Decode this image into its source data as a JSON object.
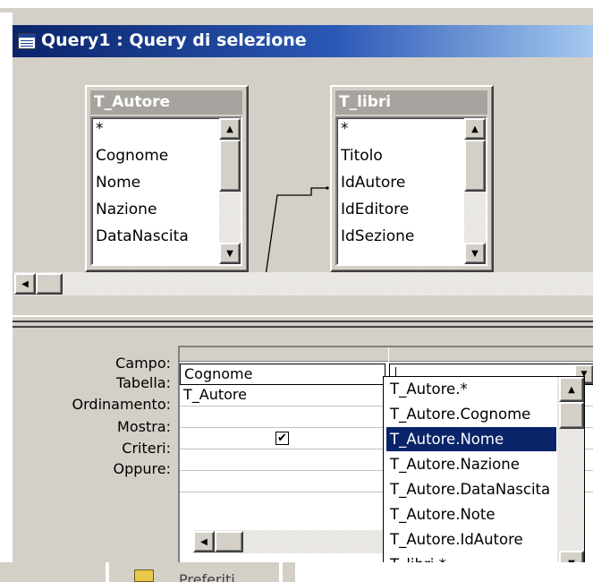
{
  "window": {
    "title": "Query1 : Query di selezione"
  },
  "tables": [
    {
      "name": "T_Autore",
      "fields": [
        "*",
        "Cognome",
        "Nome",
        "Nazione",
        "DataNascita"
      ]
    },
    {
      "name": "T_libri",
      "fields": [
        "*",
        "Titolo",
        "IdAutore",
        "IdEditore",
        "IdSezione"
      ]
    }
  ],
  "grid": {
    "row_labels": [
      "Campo:",
      "Tabella:",
      "Ordinamento:",
      "Mostra:",
      "Criteri:",
      "Oppure:"
    ],
    "column1": {
      "campo": "Cognome",
      "tabella": "T_Autore",
      "mostra_checked": true
    }
  },
  "dropdown": {
    "options": [
      "T_Autore.*",
      "T_Autore.Cognome",
      "T_Autore.Nome",
      "T_Autore.Nazione",
      "T_Autore.DataNascita",
      "T_Autore.Note",
      "T_Autore.IdAutore",
      "T_libri.*"
    ],
    "selected_index": 2
  },
  "taskbar": {
    "label": "Preferiti"
  },
  "colors": {
    "title_gradient_start": "#0a246a",
    "title_gradient_end": "#a6caf0",
    "face": "#d4d0c8",
    "selection": "#0a246a"
  }
}
